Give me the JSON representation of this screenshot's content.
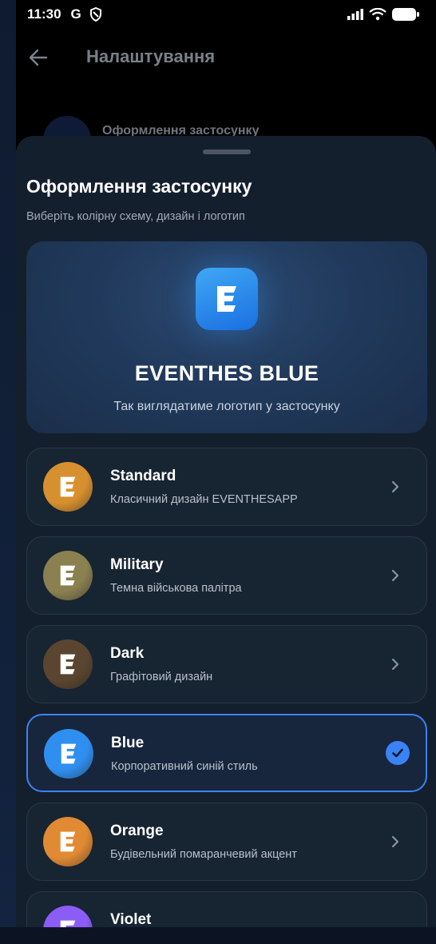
{
  "status_bar": {
    "time": "11:30",
    "g_label": "G"
  },
  "app_bar": {
    "title": "Налаштування",
    "behind_item": "Оформлення застосунку"
  },
  "sheet": {
    "title": "Оформлення застосунку",
    "subtitle": "Виберіть колірну схему, дизайн і логотип",
    "preview": {
      "name": "EVENTHES BLUE",
      "caption": "Так виглядатиме логотип у застосунку",
      "logo_letter": "E"
    },
    "themes": [
      {
        "name": "Standard",
        "desc": "Класичний дизайн EVENTHESAPP",
        "color": "#d7902f",
        "selected": false
      },
      {
        "name": "Military",
        "desc": "Темна військова палітра",
        "color": "#8a8050",
        "selected": false
      },
      {
        "name": "Dark",
        "desc": "Графітовий дизайн",
        "color": "#5a4630",
        "selected": false
      },
      {
        "name": "Blue",
        "desc": "Корпоративний синій стиль",
        "color": "#2f8ff0",
        "selected": true
      },
      {
        "name": "Orange",
        "desc": "Будівельний помаранчевий акцент",
        "color": "#e08a34",
        "selected": false
      },
      {
        "name": "Violet",
        "desc": "",
        "color": "#8b5cf6",
        "selected": false
      }
    ]
  },
  "colors": {
    "accent": "#3b82f6",
    "sheet_bg": "#141f2e",
    "card_bg": "#172432"
  }
}
